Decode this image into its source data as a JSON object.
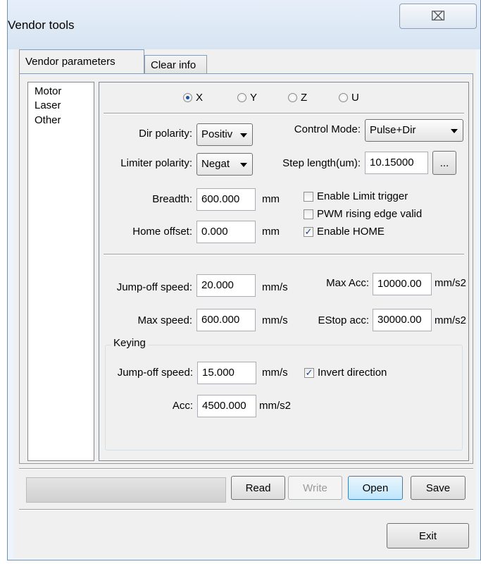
{
  "window": {
    "title": "Vendor tools",
    "close_icon": "close-icon",
    "close_glyph": "⌧"
  },
  "tabs": [
    {
      "label": "Vendor parameters",
      "active": true
    },
    {
      "label": "Clear info",
      "active": false
    }
  ],
  "nav": {
    "items": [
      "Motor",
      "Laser",
      "Other"
    ],
    "selected": "Motor"
  },
  "axes": {
    "options": [
      "X",
      "Y",
      "Z",
      "U"
    ],
    "selected": "X"
  },
  "motor": {
    "dir_polarity": {
      "label": "Dir polarity:",
      "value": "Positiv"
    },
    "control_mode": {
      "label": "Control Mode:",
      "value": "Pulse+Dir"
    },
    "limiter_polarity": {
      "label": "Limiter polarity:",
      "value": "Negat"
    },
    "step_length": {
      "label": "Step length(um):",
      "value": "10.15000",
      "browse": "..."
    },
    "breadth": {
      "label": "Breadth:",
      "value": "600.000",
      "unit": "mm"
    },
    "home_offset": {
      "label": "Home offset:",
      "value": "0.000",
      "unit": "mm"
    },
    "enable_limit_trigger": {
      "label": "Enable Limit trigger",
      "checked": false
    },
    "pwm_rising_edge": {
      "label": "PWM rising edge valid",
      "checked": false
    },
    "enable_home": {
      "label": "Enable HOME",
      "checked": true
    },
    "jump_off_speed": {
      "label": "Jump-off speed:",
      "value": "20.000",
      "unit": "mm/s"
    },
    "max_acc": {
      "label": "Max Acc:",
      "value": "10000.00",
      "unit": "mm/s2"
    },
    "max_speed": {
      "label": "Max speed:",
      "value": "600.000",
      "unit": "mm/s"
    },
    "estop_acc": {
      "label": "EStop acc:",
      "value": "30000.00",
      "unit": "mm/s2"
    }
  },
  "keying": {
    "title": "Keying",
    "jump_off_speed": {
      "label": "Jump-off speed:",
      "value": "15.000",
      "unit": "mm/s"
    },
    "invert_direction": {
      "label": "Invert direction",
      "checked": true
    },
    "acc": {
      "label": "Acc:",
      "value": "4500.000",
      "unit": "mm/s2"
    }
  },
  "actions": {
    "read": "Read",
    "write": "Write",
    "open": "Open",
    "save": "Save",
    "exit": "Exit"
  },
  "check_glyph": "✓"
}
